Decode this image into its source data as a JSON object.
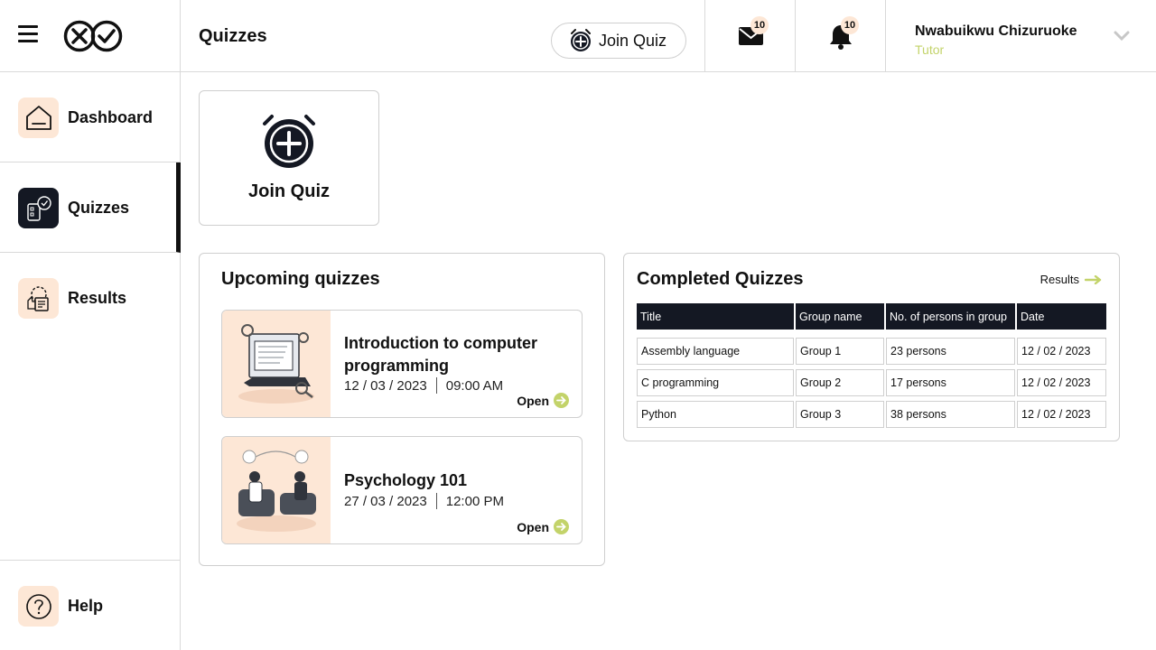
{
  "header": {
    "page_title": "Quizzes",
    "join_quiz_label": "Join Quiz",
    "mail_count": "10",
    "notification_count": "10",
    "user_name": "Nwabuikwu Chizuruoke",
    "user_role": "Tutor"
  },
  "sidebar": {
    "items": [
      {
        "label": "Dashboard",
        "icon": "home-icon"
      },
      {
        "label": "Quizzes",
        "icon": "quiz-icon",
        "active": true
      },
      {
        "label": "Results",
        "icon": "results-icon"
      }
    ],
    "help_label": "Help"
  },
  "join_tile": {
    "label": "Join Quiz"
  },
  "upcoming": {
    "title": "Upcoming quizzes",
    "quizzes": [
      {
        "title": "Introduction to computer programming",
        "date": "12 / 03 / 2023",
        "time": "09:00 AM",
        "action": "Open"
      },
      {
        "title": "Psychology 101",
        "date": "27 / 03 / 2023",
        "time": "12:00 PM",
        "action": "Open"
      }
    ]
  },
  "completed": {
    "title": "Completed Quizzes",
    "results_link": "Results",
    "columns": [
      "Title",
      "Group name",
      "No. of persons in group",
      "Date"
    ],
    "rows": [
      [
        "Assembly language",
        "Group 1",
        "23 persons",
        "12 / 02 / 2023"
      ],
      [
        "C programming",
        "Group 2",
        "17 persons",
        "12 / 02 / 2023"
      ],
      [
        "Python",
        "Group 3",
        "38 persons",
        "12 / 02 / 2023"
      ]
    ]
  },
  "colors": {
    "accent": "#c3d36a",
    "dark": "#141823",
    "peach": "#fde7d6"
  }
}
